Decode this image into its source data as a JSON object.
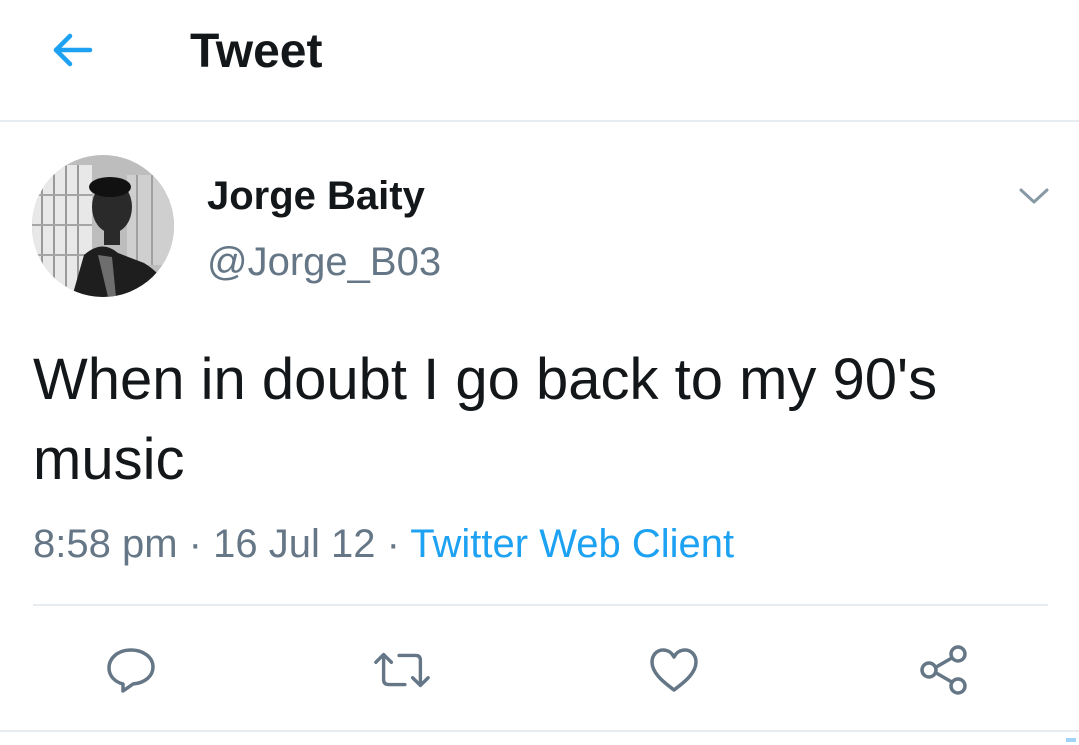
{
  "header": {
    "back_icon": "arrow-left-icon",
    "title": "Tweet"
  },
  "tweet": {
    "author_name": "Jorge Baity",
    "author_handle": "@Jorge_B03",
    "text": "When in doubt I go back to my 90's music",
    "time": "8:58 pm",
    "separator": "·",
    "date": "16 Jul 12",
    "source": "Twitter Web Client"
  },
  "actions": [
    {
      "icon": "reply-icon"
    },
    {
      "icon": "retweet-icon"
    },
    {
      "icon": "like-icon"
    },
    {
      "icon": "share-icon"
    }
  ],
  "colors": {
    "accent": "#1da1f2",
    "text": "#14171a",
    "secondary": "#657786",
    "icon": "#657786",
    "divider": "#e6ecf0"
  }
}
